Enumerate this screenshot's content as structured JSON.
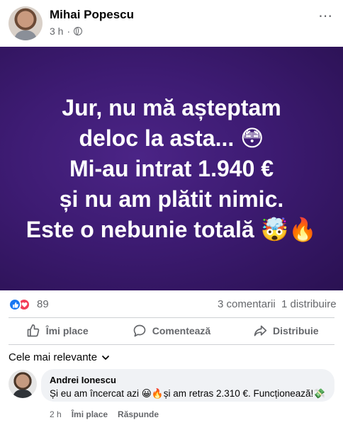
{
  "post": {
    "author": "Mihai Popescu",
    "time": "3 h",
    "separator": "·",
    "more_icon": "⋯",
    "banner_lines": [
      "Jur, nu mă așteptam",
      "deloc la asta... 😳",
      "Mi-au intrat 1.940 €",
      "și nu am plătit nimic.",
      "Este o nebunie totală 🤯🔥"
    ]
  },
  "stats": {
    "reactions_count": "89",
    "comments_count": "3 comentarii",
    "shares_count": "1 distribuire"
  },
  "actions": {
    "like": "Îmi place",
    "comment": "Comentează",
    "share": "Distribuie"
  },
  "comments_filter": "Cele mai relevante",
  "comment": {
    "author": "Andrei Ionescu",
    "text": "Și eu am încercat azi 😀🔥și am retras 2.310 €. Funcționează!💸",
    "time": "2 h",
    "like": "Îmi place",
    "reply": "Răspunde"
  },
  "colors": {
    "brand_blue": "#1877f2",
    "love_red": "#f33e58",
    "banner_purple": "#3d1b72",
    "secondary_text": "#65676b"
  }
}
